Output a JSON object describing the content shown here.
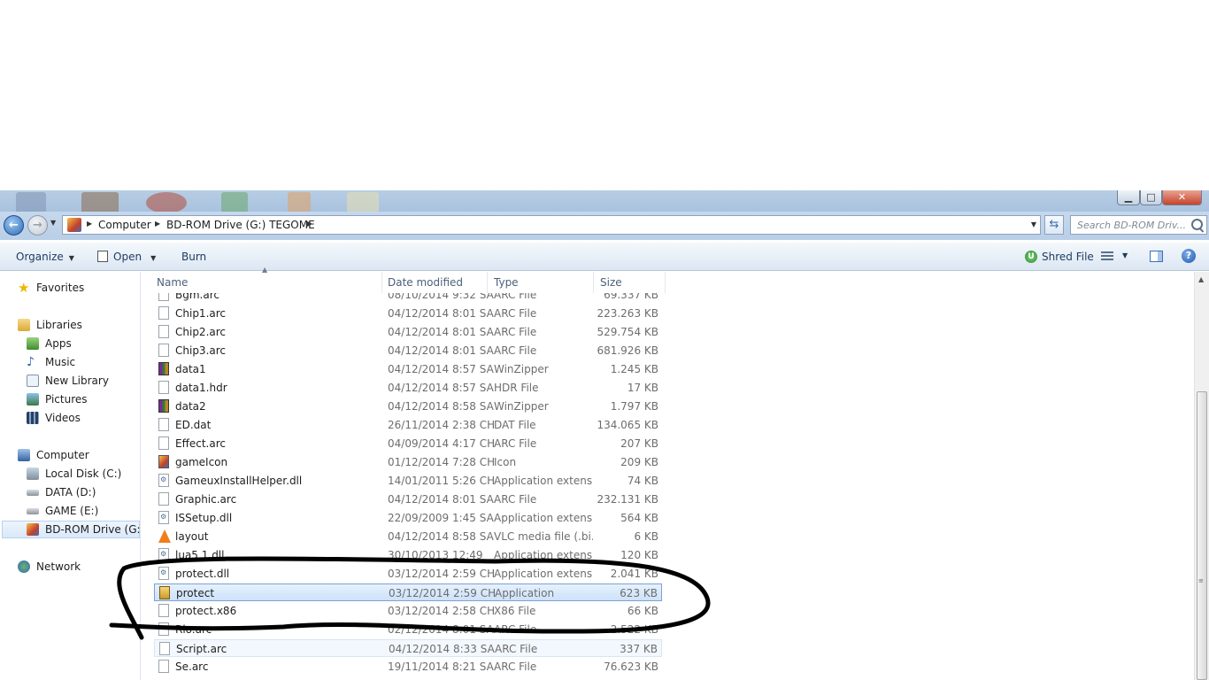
{
  "window": {
    "controls": {
      "minimize": "▁",
      "maximize": "□",
      "close": "✕"
    }
  },
  "address": {
    "crumbs": [
      "Computer",
      "BD-ROM Drive (G:) TEGOME"
    ],
    "search_placeholder": "Search BD-ROM Driv..."
  },
  "toolbar": {
    "organize": "Organize",
    "open": "Open",
    "burn": "Burn",
    "shred": "Shred File"
  },
  "nav": {
    "favorites": "Favorites",
    "libraries": "Libraries",
    "library_items": [
      "Apps",
      "Music",
      "New Library",
      "Pictures",
      "Videos"
    ],
    "computer": "Computer",
    "drives": [
      "Local Disk (C:)",
      "DATA (D:)",
      "GAME (E:)",
      "BD-ROM Drive (G:) T"
    ],
    "network": "Network"
  },
  "columns": {
    "name": "Name",
    "date": "Date modified",
    "type": "Type",
    "size": "Size"
  },
  "files": [
    {
      "name": "Bgm.arc",
      "date": "08/10/2014 9:32 SA",
      "type": "ARC File",
      "size": "69.337 KB",
      "icon": "doc"
    },
    {
      "name": "Chip1.arc",
      "date": "04/12/2014 8:01 SA",
      "type": "ARC File",
      "size": "223.263 KB",
      "icon": "doc"
    },
    {
      "name": "Chip2.arc",
      "date": "04/12/2014 8:01 SA",
      "type": "ARC File",
      "size": "529.754 KB",
      "icon": "doc"
    },
    {
      "name": "Chip3.arc",
      "date": "04/12/2014 8:01 SA",
      "type": "ARC File",
      "size": "681.926 KB",
      "icon": "doc"
    },
    {
      "name": "data1",
      "date": "04/12/2014 8:57 SA",
      "type": "WinZipper",
      "size": "1.245 KB",
      "icon": "zip"
    },
    {
      "name": "data1.hdr",
      "date": "04/12/2014 8:57 SA",
      "type": "HDR File",
      "size": "17 KB",
      "icon": "doc"
    },
    {
      "name": "data2",
      "date": "04/12/2014 8:58 SA",
      "type": "WinZipper",
      "size": "1.797 KB",
      "icon": "zip"
    },
    {
      "name": "ED.dat",
      "date": "26/11/2014 2:38 CH",
      "type": "DAT File",
      "size": "134.065 KB",
      "icon": "doc"
    },
    {
      "name": "Effect.arc",
      "date": "04/09/2014 4:17 CH",
      "type": "ARC File",
      "size": "207 KB",
      "icon": "doc"
    },
    {
      "name": "gameIcon",
      "date": "01/12/2014 7:28 CH",
      "type": "Icon",
      "size": "209 KB",
      "icon": "game"
    },
    {
      "name": "GameuxInstallHelper.dll",
      "date": "14/01/2011 5:26 CH",
      "type": "Application extens...",
      "size": "74 KB",
      "icon": "dll"
    },
    {
      "name": "Graphic.arc",
      "date": "04/12/2014 8:01 SA",
      "type": "ARC File",
      "size": "232.131 KB",
      "icon": "doc"
    },
    {
      "name": "ISSetup.dll",
      "date": "22/09/2009 1:45 SA",
      "type": "Application extens...",
      "size": "564 KB",
      "icon": "dll"
    },
    {
      "name": "layout",
      "date": "04/12/2014 8:58 SA",
      "type": "VLC media file (.bi...",
      "size": "6 KB",
      "icon": "vlc"
    },
    {
      "name": "lua5.1.dll",
      "date": "30/10/2013 12:49",
      "type": "Application extens...",
      "size": "120 KB",
      "icon": "dll"
    },
    {
      "name": "protect.dll",
      "date": "03/12/2014 2:59 CH",
      "type": "Application extens...",
      "size": "2.041 KB",
      "icon": "dll"
    },
    {
      "name": "protect",
      "date": "03/12/2014 2:59 CH",
      "type": "Application",
      "size": "623 KB",
      "icon": "app",
      "state": "selected"
    },
    {
      "name": "protect.x86",
      "date": "03/12/2014 2:58 CH",
      "type": "X86 File",
      "size": "66 KB",
      "icon": "doc"
    },
    {
      "name": "Rio.arc",
      "date": "02/12/2014 8:01 SA",
      "type": "ARC File",
      "size": "2.522 KB",
      "icon": "doc"
    },
    {
      "name": "Script.arc",
      "date": "04/12/2014 8:33 SA",
      "type": "ARC File",
      "size": "337 KB",
      "icon": "doc",
      "state": "hover"
    },
    {
      "name": "Se.arc",
      "date": "19/11/2014 8:21 SA",
      "type": "ARC File",
      "size": "76.623 KB",
      "icon": "doc"
    }
  ]
}
